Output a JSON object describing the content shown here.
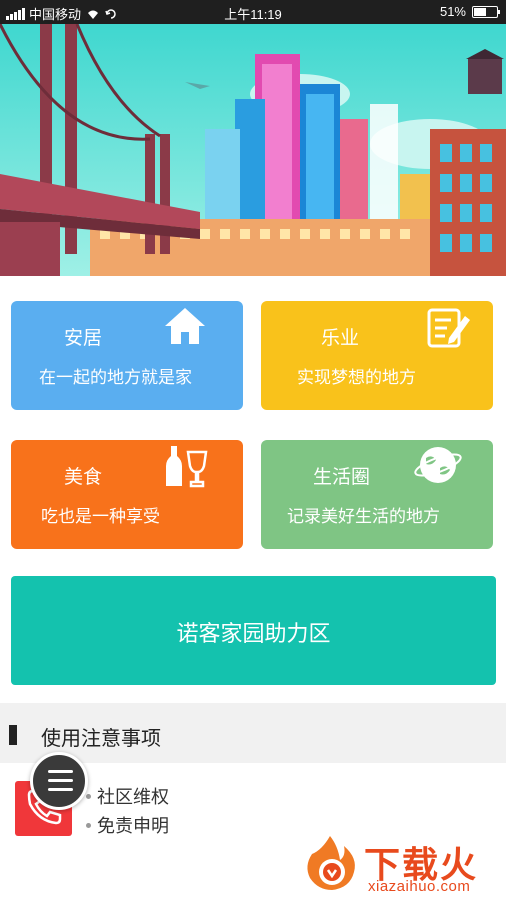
{
  "status_bar": {
    "carrier": "中国移动",
    "time": "上午11:19",
    "battery": "51%",
    "battery_level": 0.51
  },
  "tiles": [
    {
      "title": "安居",
      "subtitle": "在一起的地方就是家",
      "icon": "house-icon",
      "color": "#5aaef0"
    },
    {
      "title": "乐业",
      "subtitle": "实现梦想的地方",
      "icon": "notepad-pencil-icon",
      "color": "#f9c21b"
    },
    {
      "title": "美食",
      "subtitle": "吃也是一种享受",
      "icon": "wine-bottle-glass-icon",
      "color": "#f8721b"
    },
    {
      "title": "生活圈",
      "subtitle": "记录美好生活的地方",
      "icon": "globe-icon",
      "color": "#7fc584"
    }
  ],
  "help_zone": {
    "label": "诺客家园助力区",
    "color": "#14c2ae"
  },
  "section": {
    "title": "使用注意事项"
  },
  "notice_list": {
    "icon": "phone-icon",
    "items": [
      "社区维权",
      "免责申明"
    ]
  },
  "floating_menu": {
    "icon": "menu-icon"
  },
  "watermark": {
    "text": "下载火",
    "url": "xiazaihuo.com"
  }
}
